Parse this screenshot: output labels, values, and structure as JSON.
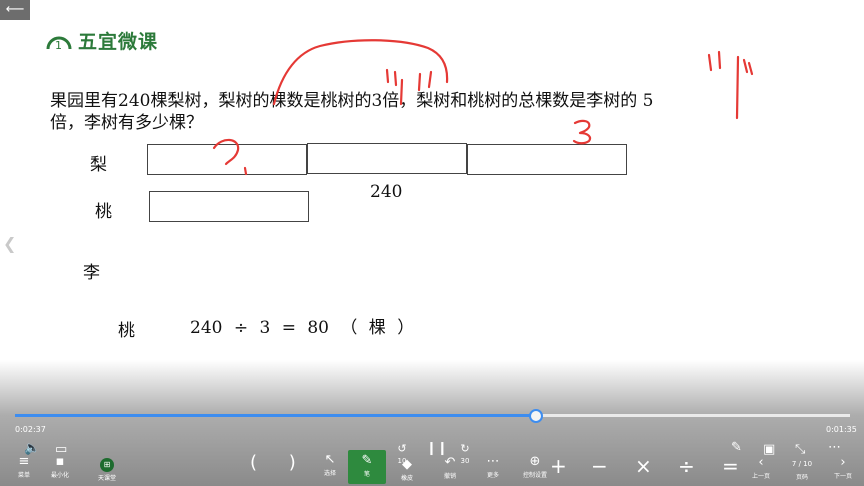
{
  "brand": {
    "title": "五宜微课"
  },
  "question": {
    "line1": "果园里有240棵梨树，梨树的棵数是桃树的3倍，梨树和桃树的总棵数是李树的 5",
    "line2": "倍，李树有多少棵？"
  },
  "diagram": {
    "pear_label": "梨",
    "peach_label": "桃",
    "plum_label": "李",
    "total_label": "240"
  },
  "equation": {
    "label": "桃",
    "expression": "240 ÷ 3 = 80 （ 棵 ）"
  },
  "annotations": {
    "mark_question": "?",
    "mark_three": "3"
  },
  "player": {
    "progress": 0.624,
    "current_time": "0:02:37",
    "remaining_time": "0:01:35",
    "accent_color": "#3d8df0",
    "active_tool_color": "#2e8a3e"
  },
  "toolbar": {
    "left": [
      {
        "icon": "menu-icon",
        "label": "菜单"
      },
      {
        "icon": "minimize-icon",
        "label": "最小化"
      },
      {
        "icon": "app-icon",
        "label": "天课堂"
      }
    ],
    "center": [
      {
        "icon": "cursor-icon",
        "label": "选择"
      },
      {
        "icon": "pen-icon",
        "label": "笔"
      },
      {
        "icon": "eraser-icon",
        "label": "橡皮"
      },
      {
        "icon": "undo-icon",
        "label": "撤销"
      },
      {
        "icon": "more-icon",
        "label": "更多"
      },
      {
        "icon": "control-icon",
        "label": "控制设置"
      }
    ],
    "rewind": "10",
    "forward": "30",
    "right": [
      {
        "icon": "prev-page-icon",
        "label": "上一页"
      },
      {
        "icon": "page-number-icon",
        "label": "页码"
      },
      {
        "icon": "next-page-icon",
        "label": "下一页"
      }
    ],
    "page_indicator": "7 / 10",
    "math_symbols": [
      "( )",
      "+",
      "−",
      "×",
      "÷",
      "="
    ]
  }
}
